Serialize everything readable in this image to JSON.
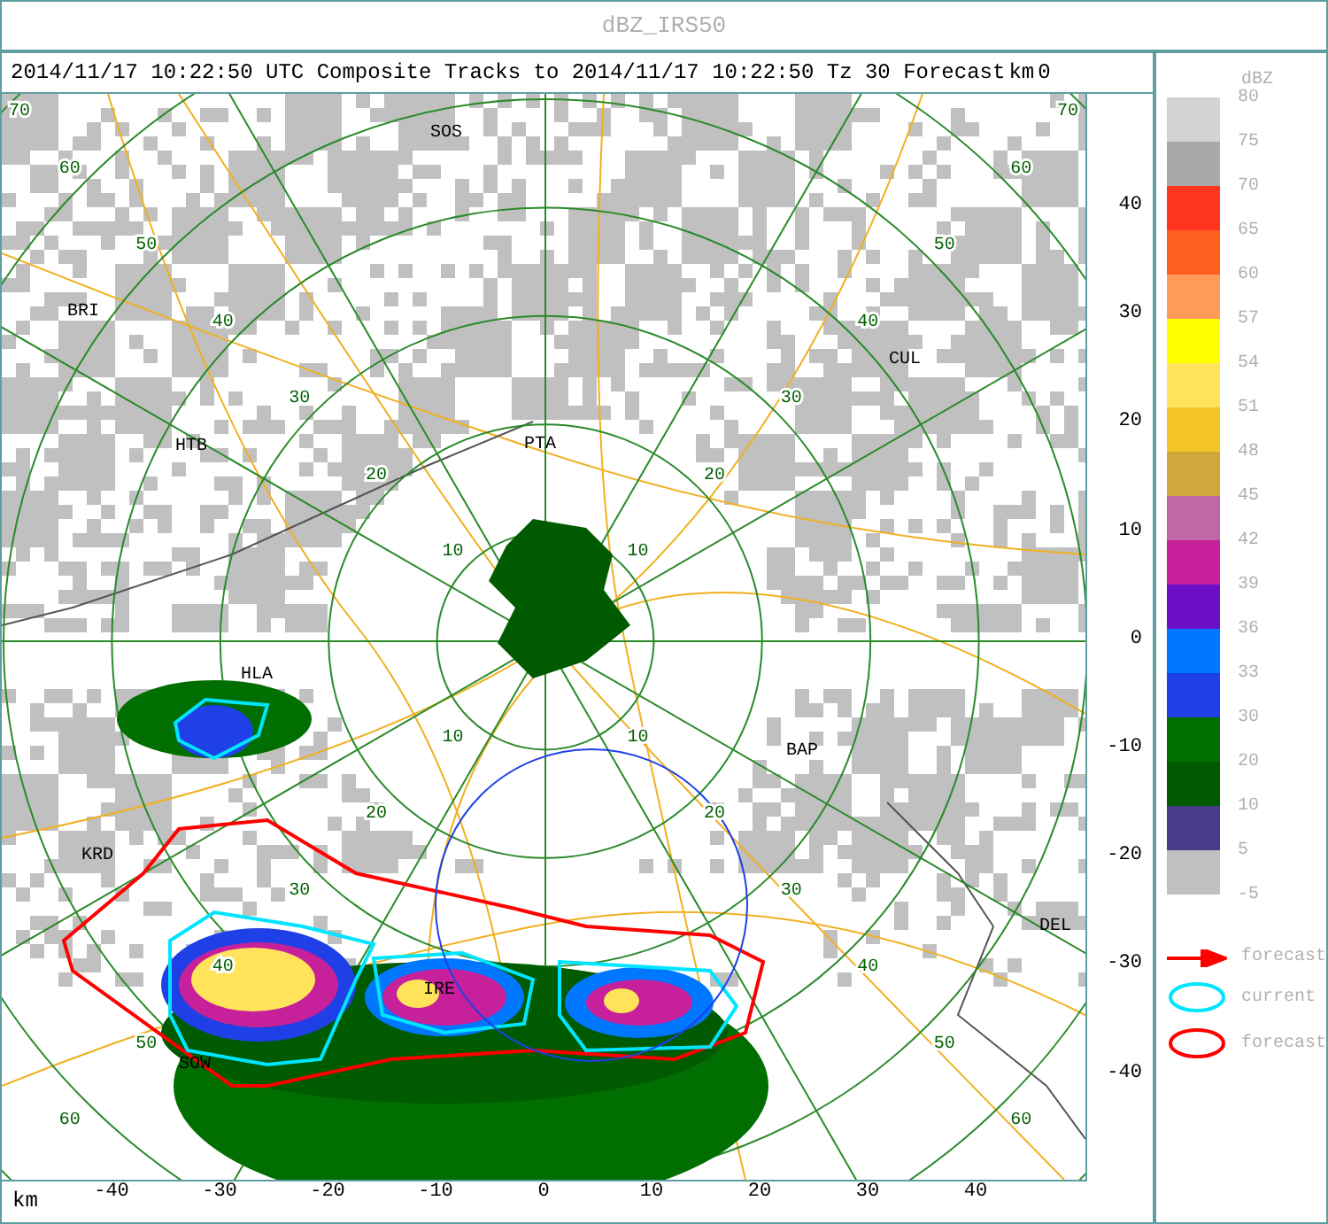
{
  "window": {
    "title": "dBZ_IRS50"
  },
  "header": {
    "text": "2014/11/17 10:22:50 UTC Composite Tracks to 2014/11/17 10:22:50 Tz 30 Forecast",
    "unit": "km",
    "trailing": "0"
  },
  "map": {
    "stations": [
      "SOS",
      "BRI",
      "HTB",
      "PTA",
      "CUL",
      "HLA",
      "BAP",
      "KRD",
      "DEL",
      "IRE",
      "SOW"
    ],
    "range_labels": [
      {
        "labels": [
          "10",
          "20",
          "30",
          "40",
          "50",
          "60",
          "70"
        ]
      },
      {
        "labels": [
          "10",
          "20",
          "30",
          "40",
          "50",
          "60",
          "70"
        ]
      },
      {
        "labels": [
          "10",
          "20",
          "30",
          "40",
          "50",
          "60"
        ]
      },
      {
        "labels": [
          "10",
          "20",
          "30",
          "40",
          "50",
          "60"
        ]
      }
    ]
  },
  "y_axis": {
    "ticks": [
      "40",
      "30",
      "20",
      "10",
      "0",
      "-10",
      "-20",
      "-30",
      "-40"
    ]
  },
  "x_axis": {
    "unit": "km",
    "ticks": [
      "-40",
      "-30",
      "-20",
      "-10",
      "0",
      "10",
      "20",
      "30",
      "40"
    ]
  },
  "legend": {
    "title": "dBZ",
    "bands": [
      {
        "label": "80",
        "color": "#d3d3d3"
      },
      {
        "label": "75",
        "color": "#a9a9a9"
      },
      {
        "label": "70",
        "color": "#ff3520"
      },
      {
        "label": "65",
        "color": "#ff6020"
      },
      {
        "label": "60",
        "color": "#ff9a5a"
      },
      {
        "label": "57",
        "color": "#ffff00"
      },
      {
        "label": "54",
        "color": "#ffe35a"
      },
      {
        "label": "51",
        "color": "#f3c528"
      },
      {
        "label": "48",
        "color": "#cfa83c"
      },
      {
        "label": "45",
        "color": "#c067a7"
      },
      {
        "label": "42",
        "color": "#c6209a"
      },
      {
        "label": "39",
        "color": "#6b10c6"
      },
      {
        "label": "36",
        "color": "#0077ff"
      },
      {
        "label": "33",
        "color": "#1e40e6"
      },
      {
        "label": "30",
        "color": "#006e00"
      },
      {
        "label": "20",
        "color": "#005a00"
      },
      {
        "label": "10",
        "color": "#483d8b"
      },
      {
        "label": "5",
        "color": "#c0c0c0"
      }
    ],
    "bottom_label": "-5",
    "keys": [
      {
        "kind": "arrow",
        "label": "forecast"
      },
      {
        "kind": "current",
        "label": "current"
      },
      {
        "kind": "forecast",
        "label": "forecast"
      }
    ]
  }
}
